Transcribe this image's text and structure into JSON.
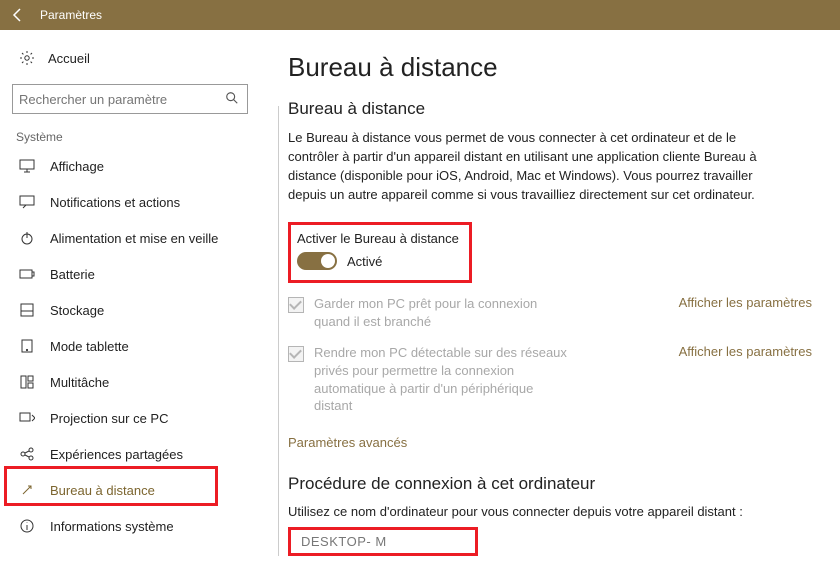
{
  "titlebar": {
    "title": "Paramètres"
  },
  "sidebar": {
    "home_label": "Accueil",
    "search_placeholder": "Rechercher un paramètre",
    "category": "Système",
    "items": [
      {
        "label": "Affichage",
        "icon": "display"
      },
      {
        "label": "Notifications et actions",
        "icon": "message"
      },
      {
        "label": "Alimentation et mise en veille",
        "icon": "power"
      },
      {
        "label": "Batterie",
        "icon": "battery"
      },
      {
        "label": "Stockage",
        "icon": "storage"
      },
      {
        "label": "Mode tablette",
        "icon": "tablet"
      },
      {
        "label": "Multitâche",
        "icon": "multitask"
      },
      {
        "label": "Projection sur ce PC",
        "icon": "project"
      },
      {
        "label": "Expériences partagées",
        "icon": "share"
      },
      {
        "label": "Bureau à distance",
        "icon": "remote",
        "active": true
      },
      {
        "label": "Informations système",
        "icon": "info"
      }
    ]
  },
  "main": {
    "page_title": "Bureau à distance",
    "section_title": "Bureau à distance",
    "description": "Le Bureau à distance vous permet de vous connecter à cet ordinateur et de le contrôler à partir d'un appareil distant en utilisant une application cliente Bureau à distance (disponible pour iOS, Android, Mac et Windows). Vous pourrez travailler depuis un autre appareil comme si vous travailliez directement sur cet ordinateur.",
    "toggle": {
      "label": "Activer le Bureau à distance",
      "state": "Activé"
    },
    "option1": {
      "text": "Garder mon PC prêt pour la connexion quand il est branché",
      "link": "Afficher les paramètres"
    },
    "option2": {
      "text": "Rendre mon PC détectable sur des réseaux privés pour permettre la connexion automatique à partir d'un périphérique distant",
      "link": "Afficher les paramètres"
    },
    "advanced_link": "Paramètres avancés",
    "connect_title": "Procédure de connexion à cet ordinateur",
    "connect_desc": "Utilisez ce nom d'ordinateur pour vous connecter depuis votre appareil distant :",
    "pc_name": "DESKTOP-          M"
  }
}
